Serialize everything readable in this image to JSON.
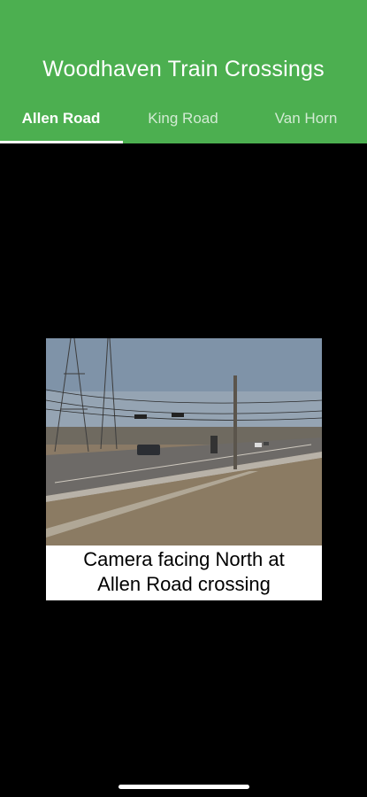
{
  "app": {
    "title": "Woodhaven Train Crossings"
  },
  "tabs": [
    {
      "label": "Allen Road",
      "active": true
    },
    {
      "label": "King Road",
      "active": false
    },
    {
      "label": "Van Horn",
      "active": false
    }
  ],
  "camera": {
    "caption": "Camera facing North at\nAllen Road crossing"
  },
  "colors": {
    "appbar": "#4CAF50",
    "background": "#000000"
  }
}
